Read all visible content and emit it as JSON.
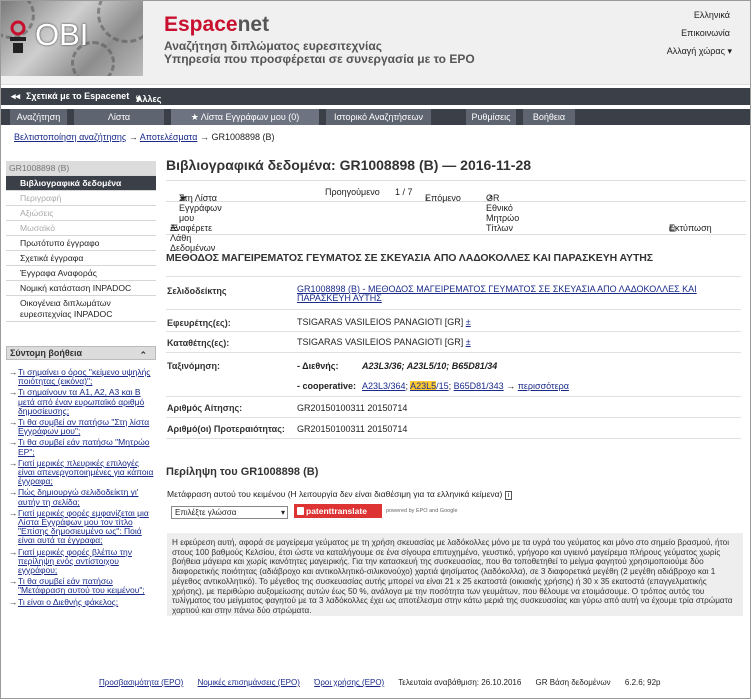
{
  "header": {
    "logo_text": "OBI",
    "brand_prefix": "Espace",
    "brand_suffix": "net",
    "tagline1": "Αναζήτηση διπλώματος ευρεσιτεχνίας",
    "tagline2": "Υπηρεσία που προσφέρεται σε συνεργασία με το EPO",
    "links": {
      "language": "Ελληνικά",
      "contact": "Επικοινωνία",
      "country": "Αλλαγή χώρας"
    }
  },
  "nav_dark": {
    "about": "Σχετικά με το Espacenet",
    "other": "Άλλες επιγραμμικές υπηρεσίες του ΕΓΔΕ"
  },
  "tabs": [
    "Αναζήτηση",
    "Λίστα αποτελεσμάτων",
    "Λίστα Εγγράφων μου (0)",
    "Ιστορικό Αναζητήσεων",
    "Ρυθμίσεις",
    "Βοήθεια"
  ],
  "breadcrumb": {
    "item1": "Βελτιστοποίηση αναζήτησης",
    "item2": "Αποτελέσματα",
    "item3": "GR1008898 (B)"
  },
  "sidebar": {
    "header": "GR1008898 (B)",
    "items": [
      {
        "label": "Βιβλιογραφικά δεδομένα"
      },
      {
        "label": "Περιγραφή"
      },
      {
        "label": "Αξιώσεις"
      },
      {
        "label": "Μωσαϊκό"
      },
      {
        "label": "Πρωτότυπο έγγραφο"
      },
      {
        "label": "Σχετικά έγγραφα"
      },
      {
        "label": "Έγγραφα Αναφοράς"
      },
      {
        "label": "Νομική κατάσταση INPADOC"
      },
      {
        "label": "Οικογένεια διπλωμάτων ευρεσιτεχνίας INPADOC"
      }
    ]
  },
  "help": {
    "title": "Σύντομη βοήθεια",
    "items": [
      "Τι σημαίνει ο όρος \"κείμενο υψηλής ποιότητας (εικόνα)\";",
      "Τι σημαίνουν τα A1, A2, A3 και B μετά από έναν ευρωπαϊκό αριθμό δημοσίευσης;",
      "Τι θα συμβεί αν πατήσω \"Στη λίστα Εγγράφων μου\";",
      "Τι θα συμβεί εάν πατήσω \"Μητρώο EP\";",
      "Γιατί μερικές πλευρικές επιλογές είναι απενεργοποιημένες για κάποια έγγραφα;",
      "Πώς δημιουργώ σελιδοδείκτη γι' αυτήν τη σελίδα;",
      "Γιατί μερικές φορές εμφανίζεται μια Λίστα Εγγράφων μου τον τίτλο \"Επίσης δημοσιευμένο ως\": Ποιά είναι αυτά τα έγγραφα;",
      "Γιατί μερικές φορές βλέπω την περίληψη ενός αντίστοιχου εγγράφου;",
      "Τι θα συμβεί εάν πατήσω \"Μετάφραση αυτού του κειμένου\";",
      "Τι είναι ο Διεθνής φάκελος;"
    ]
  },
  "main": {
    "title": "Βιβλιογραφικά δεδομένα: GR1008898 (B) — 2016-11-28",
    "toolbar": {
      "mylist": "Στη Λίστα Εγγράφων μου",
      "prev": "Προηγούμενο",
      "page": "1 / 7",
      "next": "Επόμενο",
      "register": "GR Εθνικό Μητρώο Τίτλων"
    },
    "toolbar2": {
      "report": "Αναφέρετε Λάθη Δεδομένων",
      "print": "Εκτύπωση"
    },
    "doc_title": "ΜΕΘΟΔΟΣ ΜΑΓΕΙΡΕΜΑΤΟΣ ΓΕΥΜΑΤΟΣ ΣΕ ΣΚΕΥΑΣΙΑ ΑΠΟ ΛΑΔΟΚΟΛΛΕΣ ΚΑΙ ΠΑΡΑΣΚΕΥΗ ΑΥΤΗΣ",
    "fields": {
      "bookmark_label": "Σελιδοδείκτης",
      "bookmark_value": "GR1008898 (B) - ΜΕΘΟΔΟΣ ΜΑΓΕΙΡΕΜΑΤΟΣ ΓΕΥΜΑΤΟΣ ΣΕ ΣΚΕΥΑΣΙΑ ΑΠΟ ΛΑΔΟΚΟΛΛΕΣ ΚΑΙ ΠΑΡΑΣΚΕΥΗ ΑΥΤΗΣ",
      "inventor_label": "Εφευρέτης(ες):",
      "inventor_value": "TSIGARAS VASILEIOS PANAGIOTI  [GR]",
      "applicant_label": "Καταθέτης(ες):",
      "applicant_value": "TSIGARAS VASILEIOS PANAGIOTI  [GR]",
      "class_label": "Ταξινόμηση:",
      "intl_label": "- Διεθνής:",
      "intl_value": "A23L3/36; A23L5/10; B65D81/34",
      "coop_label": "- cooperative:",
      "coop_1": "A23L3/364",
      "coop_2a": "A23L5",
      "coop_2b": "/15",
      "coop_3": "B65D81/343",
      "coop_more": "περισσότερα",
      "appno_label": "Αριθμός Αίτησης:",
      "appno_value": "GR20150100311 20150714",
      "prio_label": "Αριθμό(οι) Προτεραιότητας:",
      "prio_value": "GR20150100311 20150714"
    },
    "abstract": {
      "heading": "Περίληψη του  GR1008898 (B)",
      "translate_note": "Μετάφραση αυτού του κειμένου (Η λειτουργία δεν είναι διαθέσιμη για τα ελληνικά κείμενα)",
      "lang_select": "Επιλέξτε γλώσσα",
      "patenttranslate": "patenttranslate",
      "powered": "powered by EPO and Google",
      "text": "Η εφεύρεση αυτή, αφορά σε μαγείρεμα γεύματος με τη χρήση σκευασίας με λαδόκολλες μόνο με τα υγρά του γεύματος και μόνο στο σημείο βρασμού, ήτοι στους 100 βαθμούς Κελσίου, έτσι ώστε να καταλήγουμε σε ένα σίγουρα επιτυχημένο, γευστικό, γρήγορο και υγιεινό μαγείρεμα πλήρους γεύματος χωρίς βοήθεια μάγειρα και χωρίς ικανότητες μαγειρικής. Για την κατασκευή της συσκευασίας, που θα τοποθετηθεί το μείγμα φαγητού χρησιμοποιούμε δύο διαφορετικής ποιότητας (αδιάβροχο και αντικολλητικό-σιλικονούχο) χαρτιά ψησίματος (λαδόκολλα), σε 3 διαφορετικά μεγέθη (2 μεγέθη αδιάβροχο και 1 μέγεθος αντικολλητικό). Το μέγεθος της συσκευασίας αυτής μπορεί να είναι 21 x 25 εκατοστά (οικιακής χρήσης) ή 30 x 35 εκατοστά (επαγγελματικής χρήσης), με περιθώριο αυξομείωσης αυτών έως 50 %, ανάλογα με την ποσότητα των γευμάτων, που θέλουμε να ετοιμάσουμε. Ο τρόπος αυτός του τυλίγματος του μείγματος φαγητού με τα 3 λαδόκολλες έχει ως αποτέλεσμα στην κάτω μεριά της συσκευασίας και γύρω από αυτή να έχουμε τρία στρώματα χαρτιού και στην πάνω δύο στρώματα."
    }
  },
  "footer": {
    "accessibility": "Προσβασιμότητα (EPO)",
    "legal": "Νομικές επισημάνσεις (EPO)",
    "terms": "Όροι χρήσης (EPO)",
    "updated": "Τελευταία αναβάθμιση: 26.10.2016",
    "db": "GR Βάση δεδομένων",
    "version": "6.2.6; 92p"
  }
}
